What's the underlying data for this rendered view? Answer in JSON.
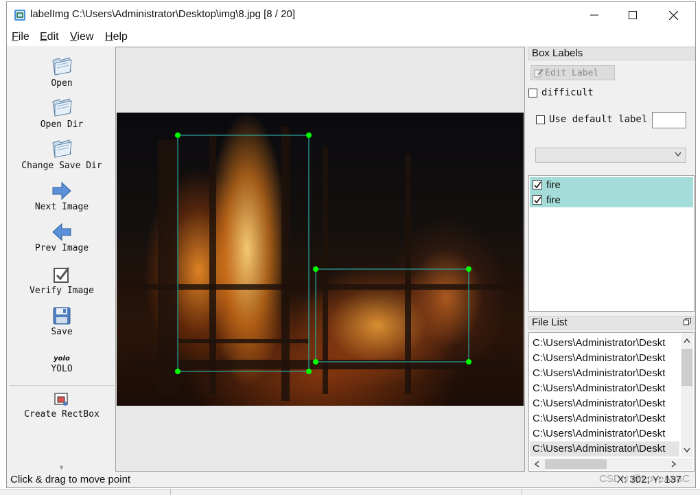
{
  "window": {
    "title": "labelImg C:\\Users\\Administrator\\Desktop\\img\\8.jpg [8 / 20]"
  },
  "menu": {
    "file": {
      "hotkey": "F",
      "rest": "ile"
    },
    "edit": {
      "hotkey": "E",
      "rest": "dit"
    },
    "view": {
      "hotkey": "V",
      "rest": "iew"
    },
    "help": {
      "hotkey": "H",
      "rest": "elp"
    }
  },
  "toolbar": {
    "open": "Open",
    "open_dir": "Open Dir",
    "change_save_dir": "Change Save Dir",
    "next_image": "Next Image",
    "prev_image": "Prev Image",
    "verify_image": "Verify Image",
    "save": "Save",
    "format_icon_text": "yolo",
    "format": "YOLO",
    "create_rectbox": "Create RectBox",
    "more": "»"
  },
  "box_labels": {
    "title": "Box Labels",
    "edit_label": "Edit Label",
    "difficult": "difficult",
    "use_default_label": "Use default label",
    "default_label_value": "",
    "combo_value": "",
    "labels": [
      {
        "text": "fire",
        "checked": true
      },
      {
        "text": "fire",
        "checked": true
      }
    ]
  },
  "file_list": {
    "title": "File List",
    "items": [
      "C:\\Users\\Administrator\\Deskt",
      "C:\\Users\\Administrator\\Deskt",
      "C:\\Users\\Administrator\\Deskt",
      "C:\\Users\\Administrator\\Deskt",
      "C:\\Users\\Administrator\\Deskt",
      "C:\\Users\\Administrator\\Deskt",
      "C:\\Users\\Administrator\\Deskt",
      "C:\\Users\\Administrator\\Deskt"
    ]
  },
  "status": {
    "message": "Click & drag to move point",
    "coords": "X: 302; Y: 137",
    "watermark": "CSDN @LoveAnaC"
  },
  "colors": {
    "box_stroke": "#2aa6a0",
    "box_vertex": "#00ff00",
    "label_row_bg": "#a3dcd8"
  }
}
